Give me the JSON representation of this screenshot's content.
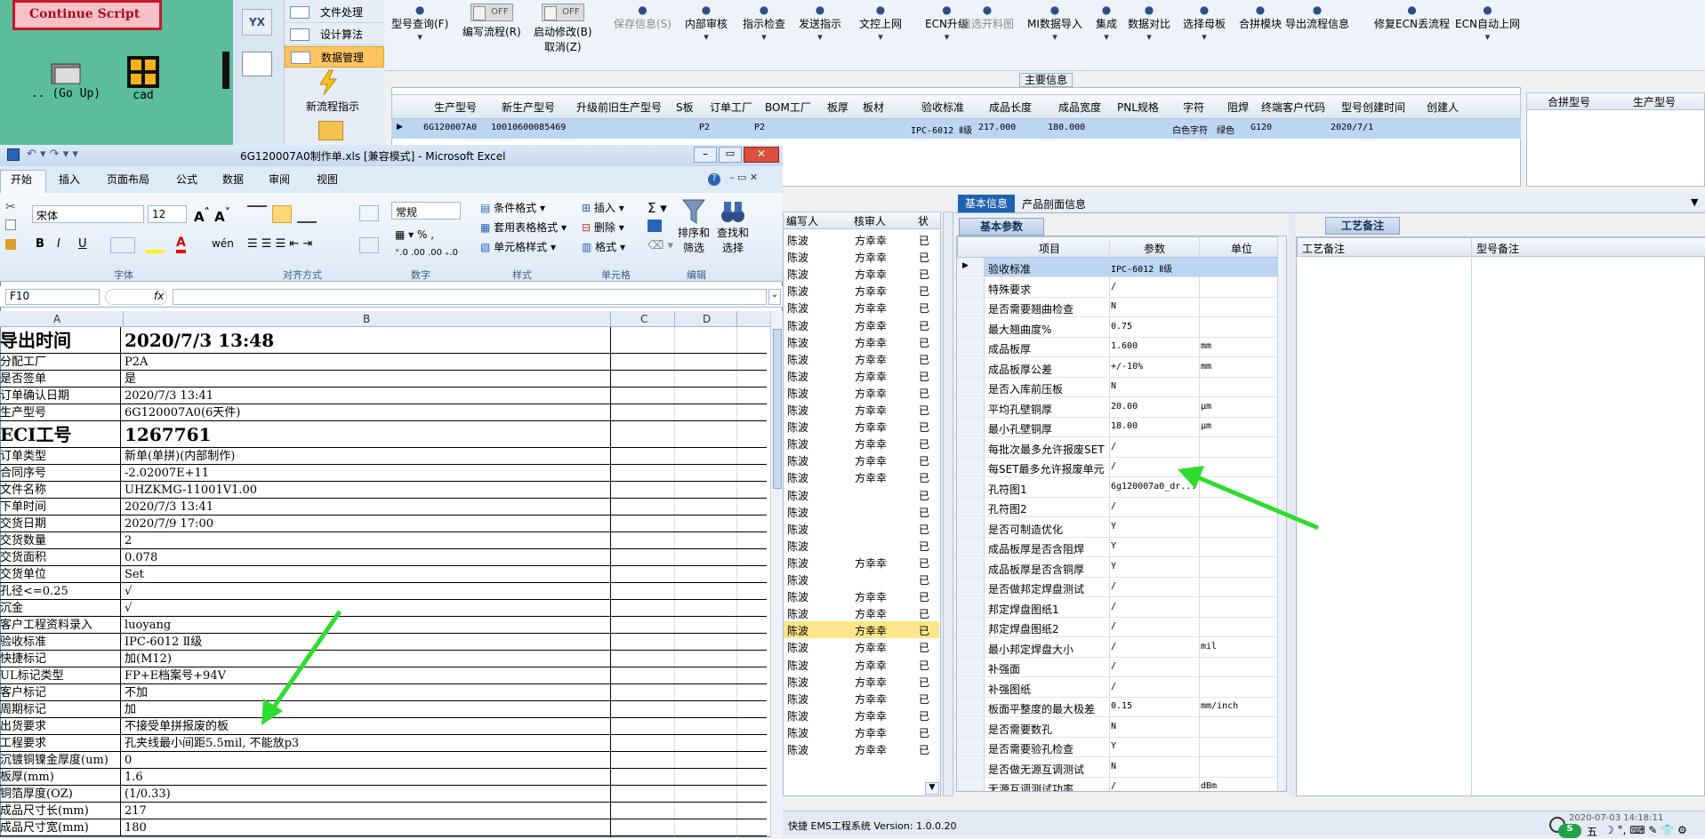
{
  "desktop": {
    "continue_label": "Continue Script",
    "go_up_label": ".. (Go Up)",
    "cad_label": "cad"
  },
  "nav": {
    "items": [
      "文件处理",
      "设计算法",
      "数据管理"
    ],
    "new_flow": "新流程指示"
  },
  "ribbon": {
    "items": [
      {
        "label": "型号查询(F)",
        "sub": "▾"
      },
      {
        "label": "编写流程(R)",
        "toggle": "OFF"
      },
      {
        "label": "启动修改(B)",
        "toggle": "OFF",
        "sub": "取消(Z)"
      },
      {
        "label": "保存信息(S)",
        "disabled": true
      },
      {
        "label": "内部审核",
        "sub": "▾"
      },
      {
        "label": "指示检查",
        "sub": "▾"
      },
      {
        "label": "发送指示",
        "sub": "▾"
      },
      {
        "label": "文控上网",
        "sub": "▾"
      },
      {
        "label": "ECN升级",
        "sub": "▾"
      },
      {
        "label": "重选开料图",
        "disabled": true
      },
      {
        "label": "MI数据导入",
        "sub": "▾"
      },
      {
        "label": "集成",
        "sub": "▾"
      },
      {
        "label": "数据对比",
        "sub": "▾"
      },
      {
        "label": "选择母板",
        "sub": "▾"
      },
      {
        "label": "合拼模块",
        "sub": ""
      },
      {
        "label": "导出流程信息",
        "sub": ""
      },
      {
        "label": "修复ECN丢流程",
        "sub": ""
      },
      {
        "label": "ECN自动上网",
        "sub": "▾"
      }
    ]
  },
  "main_info": {
    "title": "主要信息",
    "headers": [
      "生产型号",
      "新生产型号",
      "升级前旧生产型号",
      "S板",
      "订单工厂",
      "BOM工厂",
      "板厚",
      "板材",
      "验收标准",
      "成品长度",
      "成品宽度",
      "PNL规格",
      "字符",
      "阻焊",
      "终端客户代码",
      "型号创建时间",
      "创建人"
    ],
    "row": [
      "6G120007A0",
      "10010600085469",
      "",
      "",
      "P2",
      "P2",
      "",
      "",
      "IPC-6012 Ⅱ级",
      "217.000",
      "180.000",
      "",
      "白色字符",
      "绿色",
      "G120",
      "2020/7/1",
      ""
    ],
    "merge_headers": [
      "合拼型号",
      "生产型号"
    ]
  },
  "excel": {
    "title": "6G120007A0制作单.xls [兼容模式] - Microsoft Excel",
    "tabs": [
      "开始",
      "插入",
      "页面布局",
      "公式",
      "数据",
      "审阅",
      "视图"
    ],
    "font_name": "宋体",
    "font_size": "12",
    "number_format": "常规",
    "labels": {
      "cond_format": "条件格式",
      "table_format": "套用表格格式",
      "cell_style": "单元格样式",
      "insert": "插入",
      "delete": "删除",
      "format": "格式",
      "sort_filter": "排序和\n筛选",
      "find_select": "查找和\n选择"
    },
    "groups": [
      "字体",
      "对齐方式",
      "数字",
      "样式",
      "单元格",
      "编辑"
    ],
    "name_box": "F10",
    "fx": "fx",
    "columns": [
      "A",
      "B",
      "C",
      "D"
    ],
    "rows": [
      {
        "a": "导出时间",
        "b": "2020/7/3 13:48",
        "big": true
      },
      {
        "a": "分配工厂",
        "b": "P2A"
      },
      {
        "a": "是否签单",
        "b": "是"
      },
      {
        "a": "订单确认日期",
        "b": "2020/7/3 13:41"
      },
      {
        "a": "生产型号",
        "b": "6G120007A0(6天件)"
      },
      {
        "a": "ECI工号",
        "b": "1267761",
        "big": true
      },
      {
        "a": "订单类型",
        "b": "新单(单拼)(内部制作)"
      },
      {
        "a": "合同序号",
        "b": "-2.02007E+11"
      },
      {
        "a": "文件名称",
        "b": "UHZKMG-11001V1.00"
      },
      {
        "a": "下单时间",
        "b": "2020/7/3 13:41"
      },
      {
        "a": "交货日期",
        "b": "2020/7/9 17:00"
      },
      {
        "a": "交货数量",
        "b": "2"
      },
      {
        "a": "交货面积",
        "b": "0.078"
      },
      {
        "a": "交货单位",
        "b": "Set"
      },
      {
        "a": "孔径<=0.25",
        "b": "√"
      },
      {
        "a": "沉金",
        "b": "√"
      },
      {
        "a": "客户工程资料录入",
        "b": "luoyang"
      },
      {
        "a": "验收标准",
        "b": "IPC-6012 Ⅱ级"
      },
      {
        "a": "快捷标记",
        "b": "加(M12)"
      },
      {
        "a": "UL标记类型",
        "b": "FP+E档案号+94V"
      },
      {
        "a": "客户标记",
        "b": "不加"
      },
      {
        "a": "周期标记",
        "b": "加"
      },
      {
        "a": "出货要求",
        "b": "不接受单拼报废的板"
      },
      {
        "a": "工程要求",
        "b": "孔夹线最小间距5.5mil, 不能放p3"
      },
      {
        "a": "沉镀铜镍金厚度(um)",
        "b": "0"
      },
      {
        "a": "板厚(mm)",
        "b": "1.6"
      },
      {
        "a": "铜箔厚度(OZ)",
        "b": "(1/0.33)"
      },
      {
        "a": "成品尺寸长(mm)",
        "b": "217"
      },
      {
        "a": "成品尺寸宽(mm)",
        "b": "180"
      }
    ]
  },
  "midlist": {
    "headers": [
      "编写人",
      "核审人",
      "状"
    ],
    "rows": [
      [
        "陈波",
        "方幸幸",
        "已"
      ],
      [
        "陈波",
        "方幸幸",
        "已"
      ],
      [
        "陈波",
        "方幸幸",
        "已"
      ],
      [
        "陈波",
        "方幸幸",
        "已"
      ],
      [
        "陈波",
        "方幸幸",
        "已"
      ],
      [
        "陈波",
        "方幸幸",
        "已"
      ],
      [
        "陈波",
        "方幸幸",
        "已"
      ],
      [
        "陈波",
        "方幸幸",
        "已"
      ],
      [
        "陈波",
        "方幸幸",
        "已"
      ],
      [
        "陈波",
        "方幸幸",
        "已"
      ],
      [
        "陈波",
        "方幸幸",
        "已"
      ],
      [
        "陈波",
        "方幸幸",
        "已"
      ],
      [
        "陈波",
        "方幸幸",
        "已"
      ],
      [
        "陈波",
        "方幸幸",
        "已"
      ],
      [
        "陈波",
        "方幸幸",
        "已"
      ],
      [
        "陈波",
        "",
        "已"
      ],
      [
        "陈波",
        "",
        "已"
      ],
      [
        "陈波",
        "",
        "已"
      ],
      [
        "陈波",
        "",
        "已"
      ],
      [
        "陈波",
        "方幸幸",
        "已"
      ],
      [
        "陈波",
        "",
        "已"
      ],
      [
        "陈波",
        "方幸幸",
        "已"
      ],
      [
        "陈波",
        "方幸幸",
        "已"
      ],
      [
        "陈波",
        "方幸幸",
        "已"
      ],
      [
        "陈波",
        "方幸幸",
        "已"
      ],
      [
        "陈波",
        "方幸幸",
        "已"
      ],
      [
        "陈波",
        "方幸幸",
        "已"
      ],
      [
        "陈波",
        "方幸幸",
        "已"
      ],
      [
        "陈波",
        "方幸幸",
        "已"
      ],
      [
        "陈波",
        "方幸幸",
        "已"
      ],
      [
        "陈波",
        "方幸幸",
        "已"
      ]
    ],
    "highlight_index": 23
  },
  "basic": {
    "tabs": [
      "基本信息",
      "产品剖面信息"
    ],
    "subtab": "基本参数",
    "craft_tab": "工艺备注",
    "headers": [
      "项目",
      "参数",
      "单位"
    ],
    "craft_headers": [
      "工艺备注",
      "型号备注"
    ],
    "rows": [
      {
        "k": "验收标准",
        "v": "IPC-6012 Ⅱ级",
        "u": ""
      },
      {
        "k": "特殊要求",
        "v": "/",
        "u": ""
      },
      {
        "k": "是否需要翘曲检查",
        "v": "N",
        "u": ""
      },
      {
        "k": "最大翘曲度%",
        "v": "0.75",
        "u": ""
      },
      {
        "k": "成品板厚",
        "v": "1.600",
        "u": "mm"
      },
      {
        "k": "成品板厚公差",
        "v": "+/-10%",
        "u": "mm"
      },
      {
        "k": "是否入库前压板",
        "v": "N",
        "u": ""
      },
      {
        "k": "平均孔壁铜厚",
        "v": "20.00",
        "u": "μm"
      },
      {
        "k": "最小孔壁铜厚",
        "v": "18.00",
        "u": "μm"
      },
      {
        "k": "每批次最多允许报废SET",
        "v": "/",
        "u": ""
      },
      {
        "k": "每SET最多允许报废单元",
        "v": "/",
        "u": ""
      },
      {
        "k": "孔符图1",
        "v": "6g120007a0_dr...",
        "u": ""
      },
      {
        "k": "孔符图2",
        "v": "/",
        "u": ""
      },
      {
        "k": "是否可制造优化",
        "v": "Y",
        "u": ""
      },
      {
        "k": "成品板厚是否含阻焊",
        "v": "Y",
        "u": ""
      },
      {
        "k": "成品板厚是否含铜厚",
        "v": "Y",
        "u": ""
      },
      {
        "k": "是否做邦定焊盘测试",
        "v": "/",
        "u": ""
      },
      {
        "k": "邦定焊盘图纸1",
        "v": "/",
        "u": ""
      },
      {
        "k": "邦定焊盘图纸2",
        "v": "/",
        "u": ""
      },
      {
        "k": "最小邦定焊盘大小",
        "v": "/",
        "u": "mil"
      },
      {
        "k": "补强面",
        "v": "/",
        "u": ""
      },
      {
        "k": "补强图纸",
        "v": "/",
        "u": ""
      },
      {
        "k": "板面平整度的最大极差",
        "v": "0.15",
        "u": "mm/inch"
      },
      {
        "k": "是否需要数孔",
        "v": "N",
        "u": ""
      },
      {
        "k": "是否需要验孔检查",
        "v": "Y",
        "u": ""
      },
      {
        "k": "是否做无源互调测试",
        "v": "N",
        "u": ""
      },
      {
        "k": "无源互调测试功率",
        "v": "/",
        "u": "dBm"
      }
    ]
  },
  "status": {
    "text": "快捷 EMS工程系统 Version: 1.0.0.20",
    "time": "2020-07-03 14:18:11",
    "ime": "五"
  },
  "colors": {
    "accent": "#1e61b0",
    "highlight_row": "#fde68a",
    "selected_row": "#bcd5f2",
    "arrow": "#2fdc2f"
  }
}
